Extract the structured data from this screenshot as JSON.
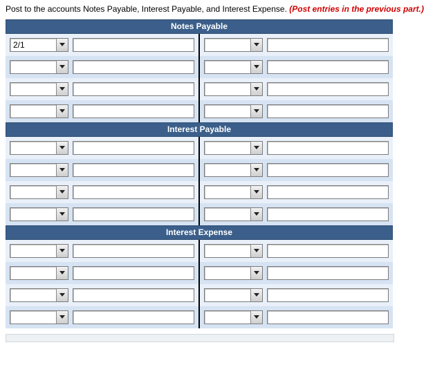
{
  "instruction": {
    "text": "Post to the accounts Notes Payable, Interest Payable, and Interest Expense. ",
    "hint": "(Post entries in the previous part.)"
  },
  "sections": [
    {
      "title": "Notes Payable",
      "rows": [
        {
          "left_date": "2/1",
          "left_amount": "",
          "right_date": "",
          "right_amount": ""
        },
        {
          "left_date": "",
          "left_amount": "",
          "right_date": "",
          "right_amount": ""
        },
        {
          "left_date": "",
          "left_amount": "",
          "right_date": "",
          "right_amount": ""
        },
        {
          "left_date": "",
          "left_amount": "",
          "right_date": "",
          "right_amount": ""
        }
      ]
    },
    {
      "title": "Interest Payable",
      "rows": [
        {
          "left_date": "",
          "left_amount": "",
          "right_date": "",
          "right_amount": ""
        },
        {
          "left_date": "",
          "left_amount": "",
          "right_date": "",
          "right_amount": ""
        },
        {
          "left_date": "",
          "left_amount": "",
          "right_date": "",
          "right_amount": ""
        },
        {
          "left_date": "",
          "left_amount": "",
          "right_date": "",
          "right_amount": ""
        }
      ]
    },
    {
      "title": "Interest Expense",
      "rows": [
        {
          "left_date": "",
          "left_amount": "",
          "right_date": "",
          "right_amount": ""
        },
        {
          "left_date": "",
          "left_amount": "",
          "right_date": "",
          "right_amount": ""
        },
        {
          "left_date": "",
          "left_amount": "",
          "right_date": "",
          "right_amount": ""
        },
        {
          "left_date": "",
          "left_amount": "",
          "right_date": "",
          "right_amount": ""
        }
      ]
    }
  ]
}
